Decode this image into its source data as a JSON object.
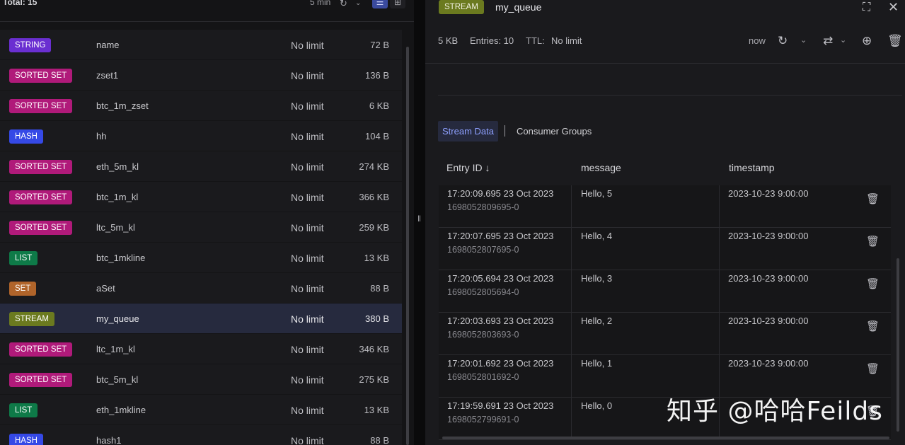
{
  "browser": {
    "total_label": "Total: 15",
    "refresh_age": "5 min",
    "keys": [
      {
        "type": "STRING",
        "color": "#6a2fd1",
        "name": "name",
        "ttl": "No limit",
        "size": "72 B"
      },
      {
        "type": "SORTED SET",
        "color": "#b01a7a",
        "name": "zset1",
        "ttl": "No limit",
        "size": "136 B"
      },
      {
        "type": "SORTED SET",
        "color": "#b01a7a",
        "name": "btc_1m_zset",
        "ttl": "No limit",
        "size": "6 KB"
      },
      {
        "type": "HASH",
        "color": "#3549e6",
        "name": "hh",
        "ttl": "No limit",
        "size": "104 B"
      },
      {
        "type": "SORTED SET",
        "color": "#b01a7a",
        "name": "eth_5m_kl",
        "ttl": "No limit",
        "size": "274 KB"
      },
      {
        "type": "SORTED SET",
        "color": "#b01a7a",
        "name": "btc_1m_kl",
        "ttl": "No limit",
        "size": "366 KB"
      },
      {
        "type": "SORTED SET",
        "color": "#b01a7a",
        "name": "ltc_5m_kl",
        "ttl": "No limit",
        "size": "259 KB"
      },
      {
        "type": "LIST",
        "color": "#0e7a48",
        "name": "btc_1mkline",
        "ttl": "No limit",
        "size": "13 KB"
      },
      {
        "type": "SET",
        "color": "#b0642a",
        "name": "aSet",
        "ttl": "No limit",
        "size": "88 B"
      },
      {
        "type": "STREAM",
        "color": "#6b7a1f",
        "name": "my_queue",
        "ttl": "No limit",
        "size": "380 B",
        "selected": true
      },
      {
        "type": "SORTED SET",
        "color": "#b01a7a",
        "name": "ltc_1m_kl",
        "ttl": "No limit",
        "size": "346 KB"
      },
      {
        "type": "SORTED SET",
        "color": "#b01a7a",
        "name": "btc_5m_kl",
        "ttl": "No limit",
        "size": "275 KB"
      },
      {
        "type": "LIST",
        "color": "#0e7a48",
        "name": "eth_1mkline",
        "ttl": "No limit",
        "size": "13 KB"
      },
      {
        "type": "HASH",
        "color": "#3549e6",
        "name": "hash1",
        "ttl": "No limit",
        "size": "88 B"
      }
    ]
  },
  "detail": {
    "type_badge": "STREAM",
    "key_name": "my_queue",
    "size": "5 KB",
    "entries": "Entries: 10",
    "ttl_label": "TTL:",
    "ttl_value": "No limit",
    "last_refresh": "now",
    "tabs": {
      "active": "Stream Data",
      "other": "Consumer Groups"
    },
    "columns": {
      "entry_id": "Entry ID",
      "sort_arrow": "↓",
      "message": "message",
      "timestamp": "timestamp"
    },
    "entries_rows": [
      {
        "date": "17:20:09.695 23 Oct 2023",
        "id": "1698052809695-0",
        "message": "Hello, 5",
        "timestamp": "2023-10-23 9:00:00"
      },
      {
        "date": "17:20:07.695 23 Oct 2023",
        "id": "1698052807695-0",
        "message": "Hello, 4",
        "timestamp": "2023-10-23 9:00:00"
      },
      {
        "date": "17:20:05.694 23 Oct 2023",
        "id": "1698052805694-0",
        "message": "Hello, 3",
        "timestamp": "2023-10-23 9:00:00"
      },
      {
        "date": "17:20:03.693 23 Oct 2023",
        "id": "1698052803693-0",
        "message": "Hello, 2",
        "timestamp": "2023-10-23 9:00:00"
      },
      {
        "date": "17:20:01.692 23 Oct 2023",
        "id": "1698052801692-0",
        "message": "Hello, 1",
        "timestamp": "2023-10-23 9:00:00"
      },
      {
        "date": "17:19:59.691 23 Oct 2023",
        "id": "1698052799691-0",
        "message": "Hello, 0",
        "timestamp": ""
      }
    ]
  },
  "watermark": "知乎 @哈哈Feilds"
}
